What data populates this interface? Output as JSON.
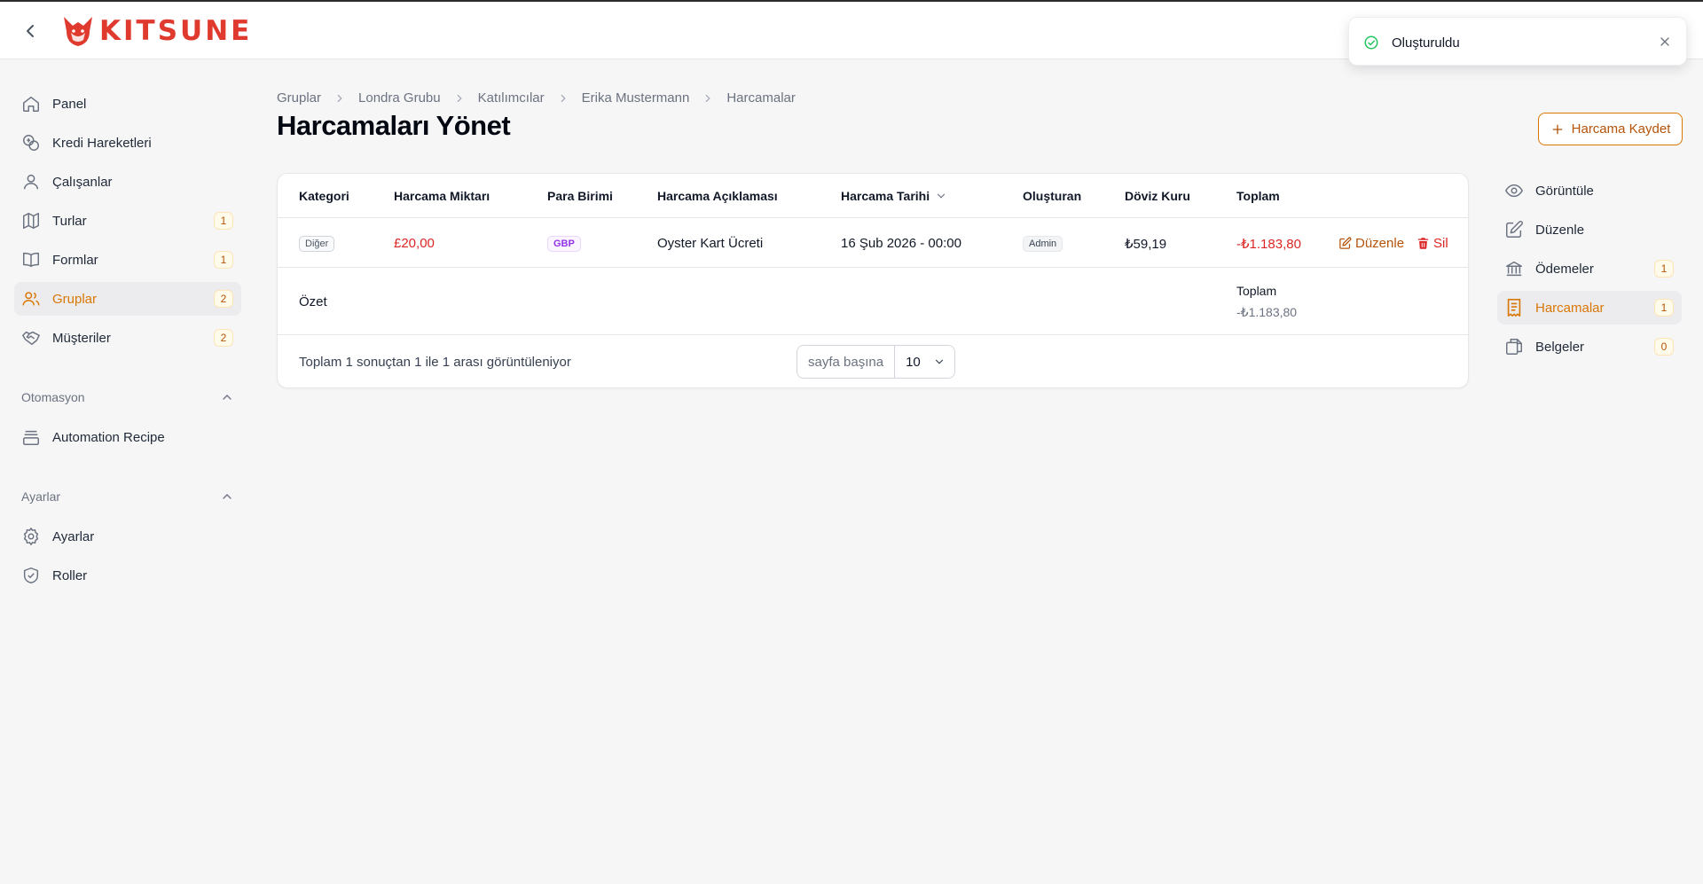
{
  "app": {
    "brand": "KITSUNE"
  },
  "sidebar": {
    "items": [
      {
        "label": "Panel",
        "badge": ""
      },
      {
        "label": "Kredi Hareketleri",
        "badge": ""
      },
      {
        "label": "Çalışanlar",
        "badge": ""
      },
      {
        "label": "Turlar",
        "badge": "1"
      },
      {
        "label": "Formlar",
        "badge": "1"
      },
      {
        "label": "Gruplar",
        "badge": "2"
      },
      {
        "label": "Müşteriler",
        "badge": "2"
      }
    ],
    "groups": [
      {
        "label": "Otomasyon",
        "items": [
          {
            "label": "Automation Recipe"
          }
        ]
      },
      {
        "label": "Ayarlar",
        "items": [
          {
            "label": "Ayarlar"
          },
          {
            "label": "Roller"
          }
        ]
      }
    ]
  },
  "breadcrumb": [
    "Gruplar",
    "Londra Grubu",
    "Katılımcılar",
    "Erika Mustermann",
    "Harcamalar"
  ],
  "page": {
    "title": "Harcamaları Yönet",
    "create_button": "Harcama Kaydet"
  },
  "table": {
    "columns": [
      "Kategori",
      "Harcama Miktarı",
      "Para Birimi",
      "Harcama Açıklaması",
      "Harcama Tarihi",
      "Oluşturan",
      "Döviz Kuru",
      "Toplam"
    ],
    "rows": [
      {
        "category": "Diğer",
        "amount": "£20,00",
        "currency": "GBP",
        "description": "Oyster Kart Ücreti",
        "date": "16 Şub 2026 - 00:00",
        "creator": "Admin",
        "rate": "₺59,19",
        "total": "-₺1.183,80",
        "edit_label": "Düzenle",
        "delete_label": "Sil"
      }
    ],
    "summary": {
      "label": "Özet",
      "total_label": "Toplam",
      "total_value": "-₺1.183,80"
    },
    "footer": {
      "count_text": "Toplam 1 sonuçtan 1 ile 1 arası görüntüleniyor",
      "per_page_label": "sayfa başına",
      "per_page_value": "10"
    }
  },
  "subnav": {
    "items": [
      {
        "label": "Görüntüle",
        "badge": ""
      },
      {
        "label": "Düzenle",
        "badge": ""
      },
      {
        "label": "Ödemeler",
        "badge": "1"
      },
      {
        "label": "Harcamalar",
        "badge": "1"
      },
      {
        "label": "Belgeler",
        "badge": "0"
      }
    ]
  },
  "toast": {
    "message": "Oluşturuldu"
  },
  "colors": {
    "accent": "#d97706",
    "brand": "#e03a2e",
    "danger": "#dc2626",
    "success": "#22c55e"
  }
}
